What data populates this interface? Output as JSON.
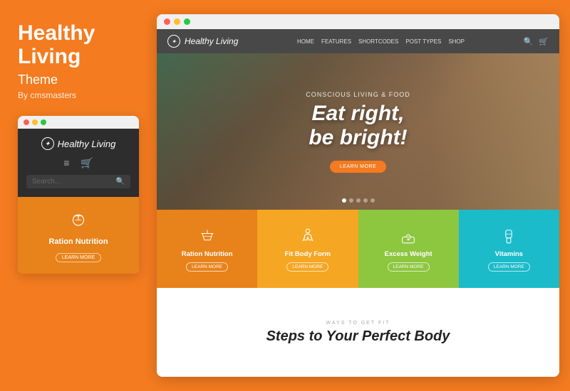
{
  "left": {
    "title": "Healthy Living",
    "subtitle": "Theme",
    "by": "By cmsmasters",
    "mobile_dots": [
      "red",
      "yellow",
      "green"
    ],
    "logo_text": "Healthy Living",
    "search_placeholder": "Search...",
    "card_title": "Ration Nutrition",
    "learn_more": "LEARN MORE"
  },
  "browser": {
    "nav": {
      "logo": "Healthy Living",
      "links": [
        "HOME",
        "FEATURES",
        "SHORTCODES",
        "POST TYPES",
        "SHOP"
      ]
    },
    "hero": {
      "subtitle": "Conscious Living & Food",
      "title_line1": "Eat right,",
      "title_line2": "be bright!",
      "btn_label": "LEARN MORE"
    },
    "tiles": [
      {
        "title": "Ration Nutrition",
        "learn": "LEARN MORE",
        "icon": "scale"
      },
      {
        "title": "Fit Body Form",
        "learn": "LEARN MORE",
        "icon": "body"
      },
      {
        "title": "Excess Weight",
        "learn": "LEARN MORE",
        "icon": "weight"
      },
      {
        "title": "Vitamins",
        "learn": "LEARN MORE",
        "icon": "vitamins"
      }
    ],
    "bottom": {
      "ways_label": "WAYS TO GET FIT",
      "steps_title": "Steps to Your Perfect Body"
    }
  }
}
